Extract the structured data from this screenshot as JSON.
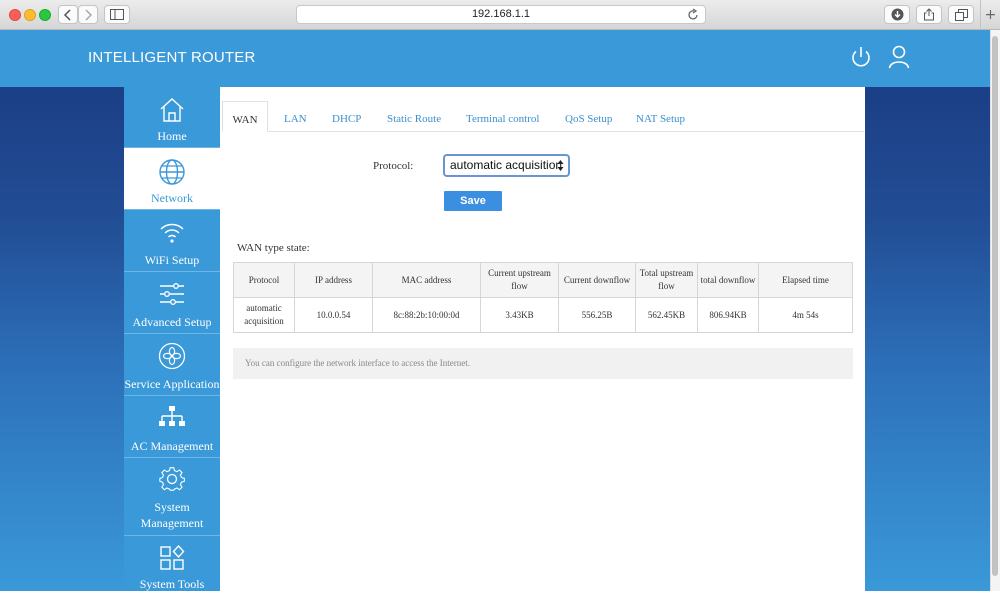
{
  "browser": {
    "url": "192.168.1.1",
    "new_tab": "+"
  },
  "header": {
    "brand": "INTELLIGENT ROUTER",
    "power_icon": "power-icon",
    "user_icon": "user-icon"
  },
  "sidebar": {
    "items": [
      {
        "label": "Home",
        "icon": "home-icon"
      },
      {
        "label": "Network",
        "icon": "globe-icon",
        "active": true
      },
      {
        "label": "WiFi Setup",
        "icon": "wifi-icon"
      },
      {
        "label": "Advanced Setup",
        "icon": "sliders-icon"
      },
      {
        "label": "Service Application",
        "icon": "service-icon"
      },
      {
        "label": "AC Management",
        "icon": "network-tree-icon"
      },
      {
        "label_line1": "System",
        "label_line2": "Management",
        "icon": "gear-icon"
      },
      {
        "label": "System Tools",
        "icon": "tools-icon"
      }
    ]
  },
  "tabs": [
    "WAN",
    "LAN",
    "DHCP",
    "Static Route",
    "Terminal control",
    "QoS Setup",
    "NAT Setup"
  ],
  "active_tab": "WAN",
  "form": {
    "protocol_label": "Protocol:",
    "protocol_value": "automatic acquisition",
    "save_label": "Save"
  },
  "wan_state": {
    "title": "WAN type state:",
    "columns": [
      [
        "Protocol"
      ],
      [
        "IP address"
      ],
      [
        "MAC address"
      ],
      [
        "Current upstream",
        "flow"
      ],
      [
        "Current downflow"
      ],
      [
        "Total upstream",
        "flow"
      ],
      [
        "total downflow"
      ],
      [
        "Elapsed time"
      ]
    ],
    "row": {
      "protocol_line1": "automatic",
      "protocol_line2": "acquisition",
      "ip": "10.0.0.54",
      "mac": "8c:88:2b:10:00:0d",
      "current_up": "3.43KB",
      "current_down": "556.25B",
      "total_up": "562.45KB",
      "total_down": "806.94KB",
      "elapsed": "4m 54s"
    }
  },
  "info": "You can configure the network interface to access the Internet.",
  "colors": {
    "brand_blue": "#3a99d8",
    "link_blue": "#3a8fd0",
    "upstream_green": "#2e7a2e",
    "downflow_orange": "#e29a2a"
  }
}
